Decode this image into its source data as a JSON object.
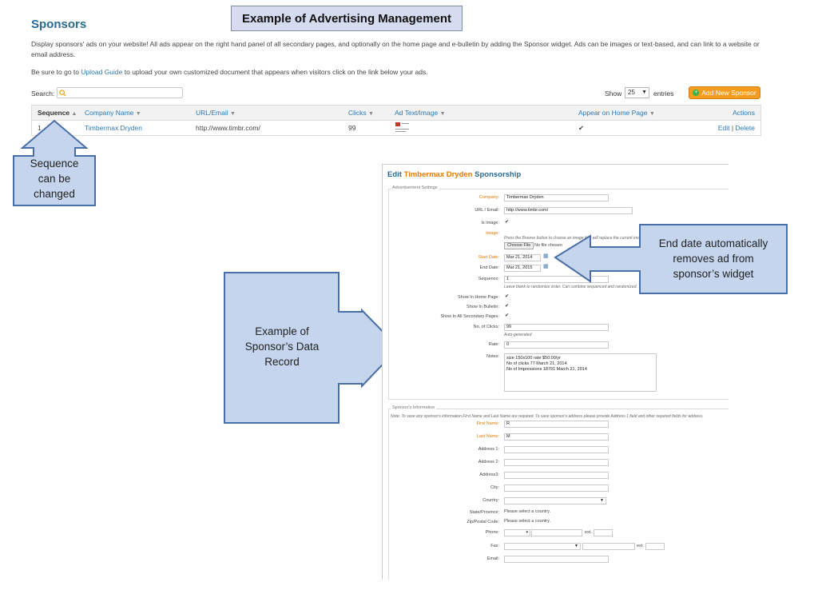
{
  "slide": {
    "title": "Example of Advertising Management",
    "callout_sequence": [
      "Sequence",
      "can be",
      "changed"
    ],
    "callout_record": [
      "Example of",
      "Sponsor’s Data",
      "Record"
    ],
    "callout_enddate": [
      "End date automatically",
      "removes ad from",
      "sponsor’s widget"
    ]
  },
  "page": {
    "heading": "Sponsors",
    "description": "Display sponsors' ads on your website! All ads appear on the right hand panel of all secondary pages, and optionally on the home page and e-bulletin by adding the Sponsor widget. Ads can be images or text-based, and can link to a website or email address.",
    "upload_prefix": "Be sure to go to",
    "upload_link": "Upload Guide",
    "upload_suffix": "to upload your own customized document that appears when visitors click on the link below your ads.",
    "search_label": "Search:",
    "search_icon": "magnifier-icon",
    "show_label": "Show",
    "show_value": "25",
    "entries_label": "entries",
    "add_button": "Add New Sponsor"
  },
  "table": {
    "headers": {
      "sequence": "Sequence",
      "company": "Company Name",
      "url": "URL/Email",
      "clicks": "Clicks",
      "ad": "Ad Text/Image",
      "home": "Appear on Home Page",
      "actions": "Actions"
    },
    "sort_asc": "▲",
    "sort_arrow": "▼",
    "rows": [
      {
        "sequence": "1",
        "company": "Timbermax Dryden",
        "url": "http://www.timbr.com/",
        "clicks": "99",
        "home": "✔",
        "edit": "Edit",
        "sep": "|",
        "delete": "Delete"
      }
    ]
  },
  "form": {
    "title_prefix": "Edit",
    "title_name": "Timbermax Dryden",
    "title_suffix": "Sponsorship",
    "ad_settings_legend": "Advertisement Settings",
    "company_label": "Company:",
    "company_value": "Timbermax Dryden",
    "url_label": "URL / Email:",
    "url_value": "http://www.timbr.com/",
    "is_image_label": "Is Image:",
    "image_label": "Image:",
    "image_hint": "Press the Browse button to choose an image that will replace the current image.",
    "choose_file": "Choose File",
    "no_file": "No file chosen",
    "start_label": "Start Date:",
    "start_value": "Mar 21, 2014",
    "end_label": "End Date:",
    "end_value": "Mar 21, 2015",
    "sequence_label": "Sequence:",
    "sequence_value": "1",
    "sequence_hint": "Leave blank to randomize order. Can combine sequenced and randomized.",
    "home_label": "Show In Home Page:",
    "bulletin_label": "Show In Bulletin:",
    "secondary_label": "Show In All Secondary Pages:",
    "clicks_label": "No. of Clicks:",
    "clicks_value": "99",
    "clicks_hint": "Auto-generated",
    "rate_label": "Rate:",
    "rate_value": "0",
    "notes_label": "Notes:",
    "notes_lines": [
      "size 150x100 rate $50.00/yr",
      "No of clicks 77  March 21, 2014",
      "No of Impressions 18791 March 21, 2014"
    ],
    "check": "✔",
    "calendar_icon": "calendar-icon",
    "sponsor_info_legend": "Sponsor's Information",
    "sponsor_note": "Note: To save any sponsor's information First Name and Last Name are required. To save sponsor's address please provide Address 1 field and other required fields for address.",
    "first_label": "First Name:",
    "first_value": "R",
    "last_label": "Last Name:",
    "last_value": "M",
    "addr1_label": "Address 1:",
    "addr2_label": "Address 2:",
    "addr3_label": "Address3:",
    "city_label": "City:",
    "country_label": "Country:",
    "state_label": "State/Province:",
    "state_value": "Please select a country.",
    "zip_label": "Zip/Postal Code:",
    "zip_value": "Please select a country.",
    "phone_label": "Phone:",
    "fax_label": "Fax:",
    "ext_label": "ext.",
    "email_label": "Email:"
  },
  "colors": {
    "link": "#2a7ab8",
    "heading": "#2a6a96",
    "accent_orange": "#f39c1e",
    "callout_fill": "#c5d5ee",
    "callout_stroke": "#4a6fa5"
  }
}
